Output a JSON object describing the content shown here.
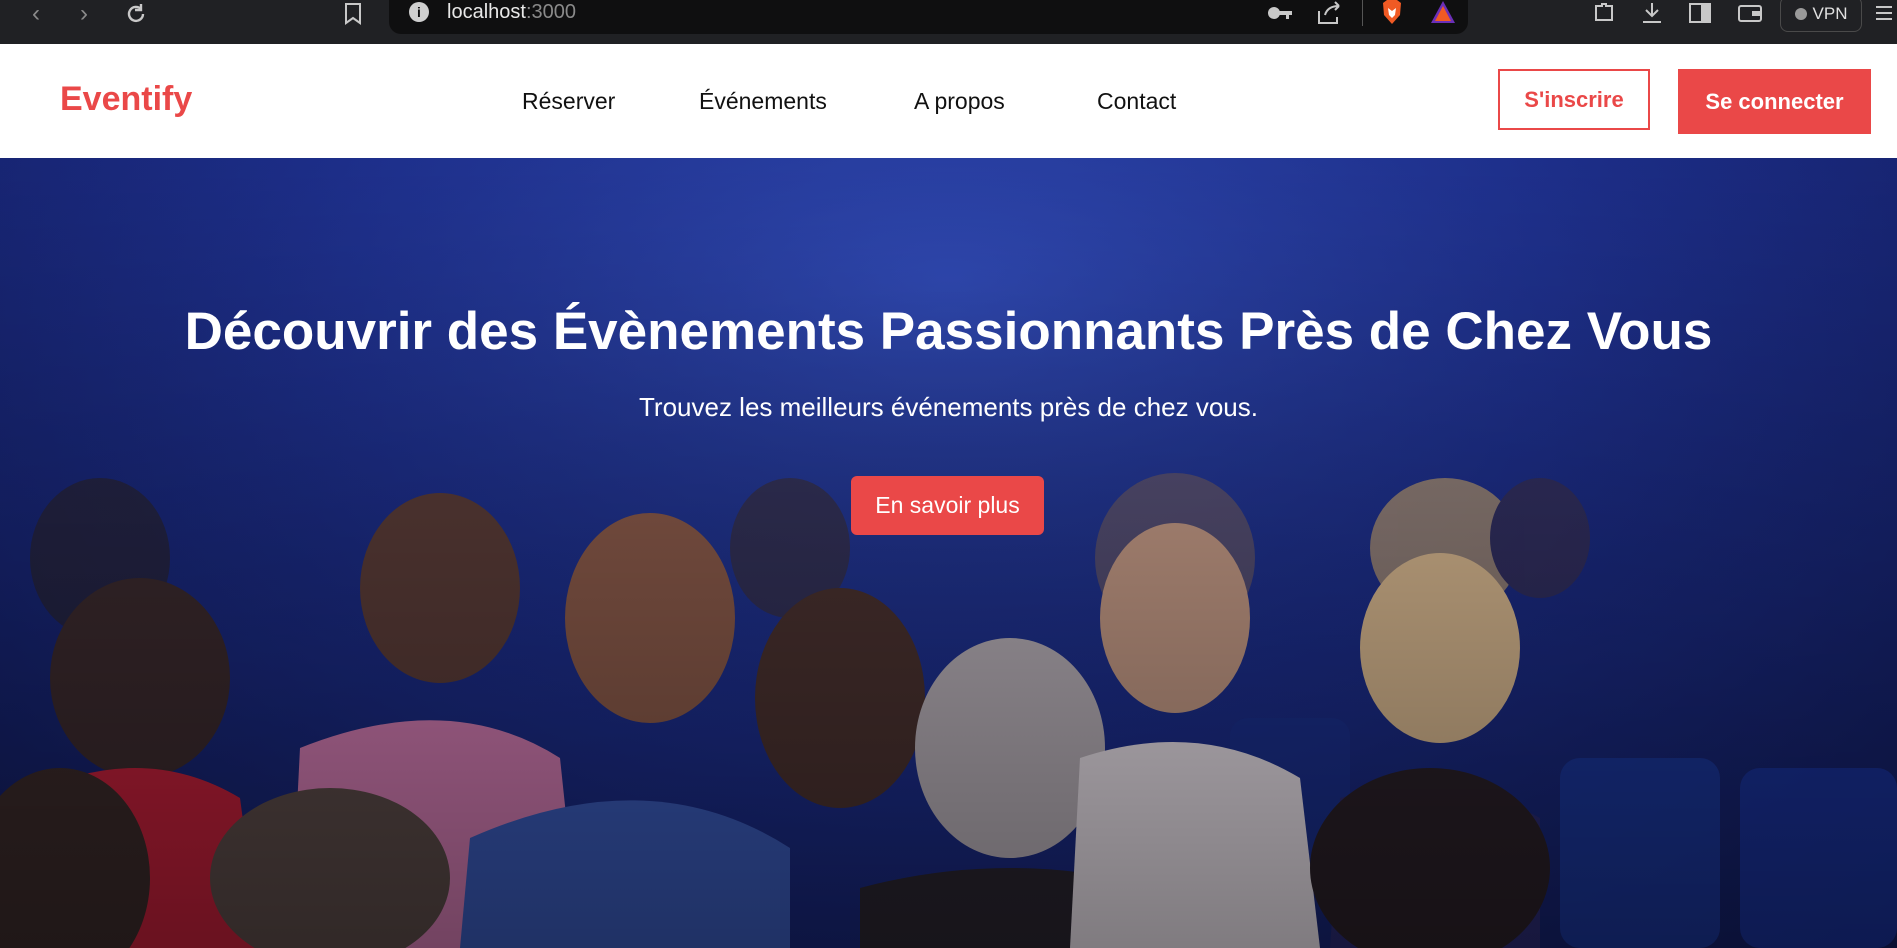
{
  "browser": {
    "url_host": "localhost",
    "url_port": ":3000",
    "vpn_label": "VPN",
    "icons": [
      "back-icon",
      "forward-icon",
      "reload-icon",
      "bookmark-icon",
      "info-icon",
      "key-icon",
      "share-icon",
      "brave-shield-icon",
      "brave-rewards-icon",
      "extensions-icon",
      "download-icon",
      "sidebar-icon",
      "wallet-icon",
      "menu-icon"
    ]
  },
  "site": {
    "logo": "Eventify",
    "nav": [
      "Réserver",
      "Événements",
      "A propos",
      "Contact"
    ],
    "signup_label": "S'inscrire",
    "login_label": "Se connecter",
    "accent_color": "#ea4848"
  },
  "hero": {
    "title": "Découvrir des Évènements Passionnants Près de Chez Vous",
    "subtitle": "Trouvez les meilleurs événements près de chez vous.",
    "cta_label": "En savoir plus"
  }
}
